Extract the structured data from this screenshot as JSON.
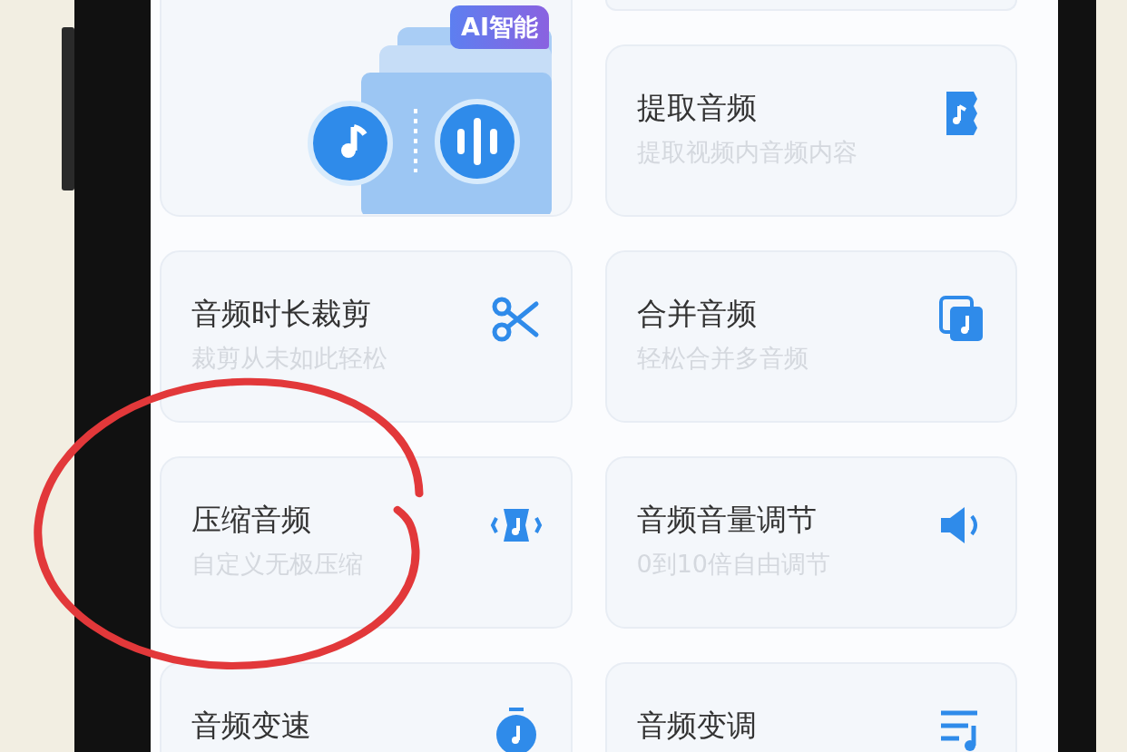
{
  "hero": {
    "badge": "AI智能"
  },
  "tools": [
    {
      "title": "提取音频",
      "subtitle": "提取视频内音频内容"
    },
    {
      "title": "音频时长裁剪",
      "subtitle": "裁剪从未如此轻松"
    },
    {
      "title": "合并音频",
      "subtitle": "轻松合并多音频"
    },
    {
      "title": "压缩音频",
      "subtitle": "自定义无极压缩"
    },
    {
      "title": "音频音量调节",
      "subtitle": "0到10倍自由调节"
    },
    {
      "title": "音频变速"
    },
    {
      "title": "音频变调"
    }
  ],
  "annotation": {
    "kind": "circle"
  }
}
